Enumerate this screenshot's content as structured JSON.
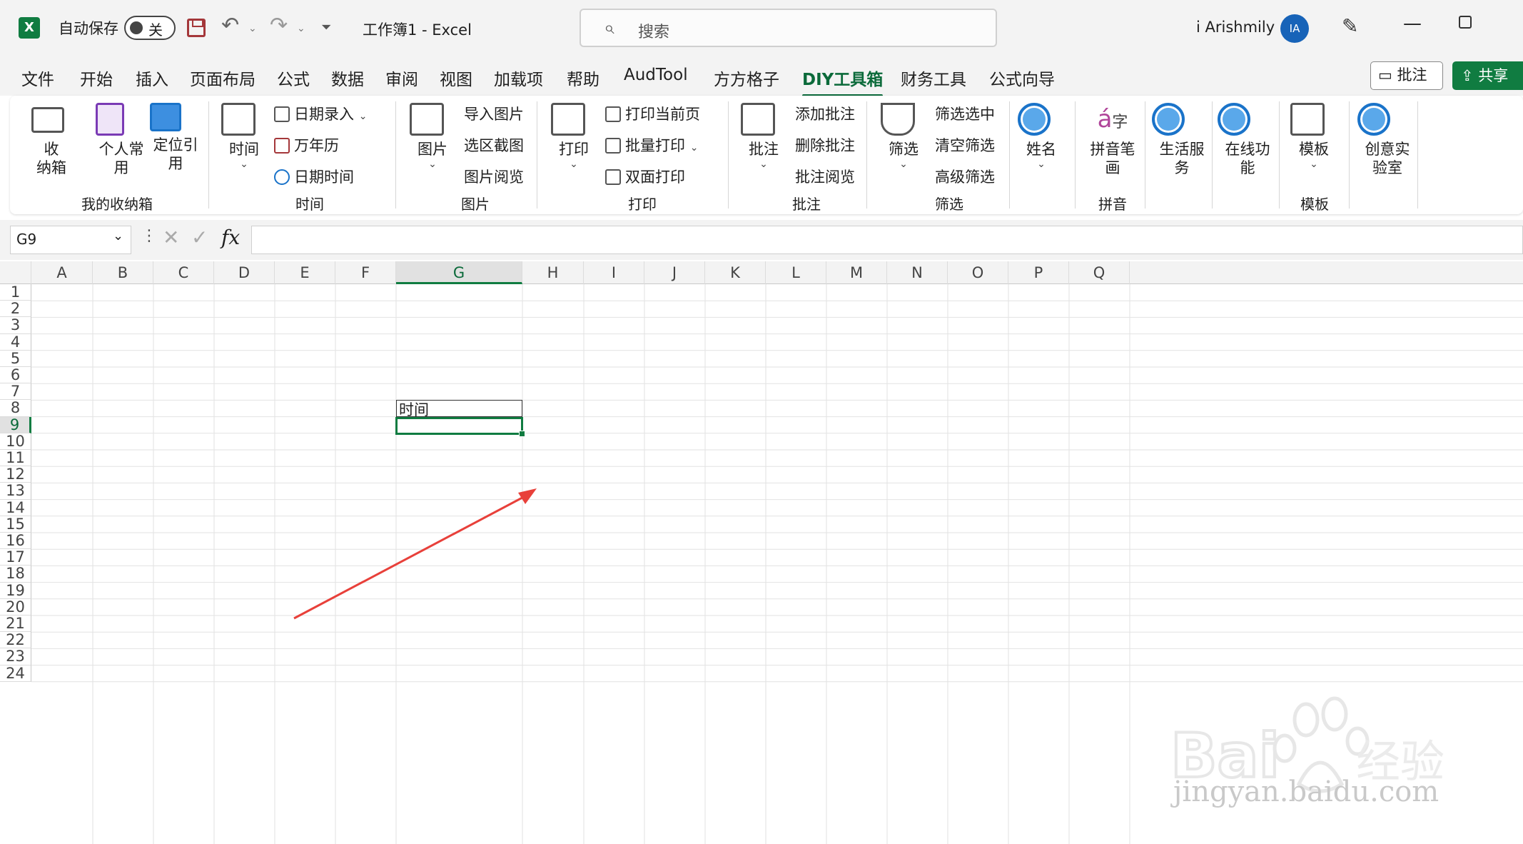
{
  "titlebar": {
    "autosave_label": "自动保存",
    "autosave_state": "关",
    "doc_title": "工作簿1  -  Excel",
    "search_placeholder": "搜索",
    "user_name": "i Arishmily",
    "avatar_initials": "IA",
    "app_logo": "X"
  },
  "tabs": [
    "文件",
    "开始",
    "插入",
    "页面布局",
    "公式",
    "数据",
    "审阅",
    "视图",
    "加载项",
    "帮助",
    "AudTool",
    "方方格子",
    "DIY工具箱",
    "财务工具",
    "公式向导"
  ],
  "active_tab": "DIY工具箱",
  "actions": {
    "comments_label": "批注",
    "share_label": "共享"
  },
  "ribbon": {
    "storage": {
      "btn1": "收\n纳箱",
      "btn2": "个人常\n用",
      "btn3": "定位引\n用",
      "group": "我的收纳箱"
    },
    "time": {
      "big": "时间",
      "s1": "日期录入",
      "s2": "万年历",
      "s3": "日期时间",
      "group": "时间"
    },
    "picture": {
      "big": "图片",
      "s1": "导入图片",
      "s2": "选区截图",
      "s3": "图片阅览",
      "group": "图片"
    },
    "print": {
      "big": "打印",
      "s1": "打印当前页",
      "s2": "批量打印",
      "s3": "双面打印",
      "group": "打印"
    },
    "comment": {
      "big": "批注",
      "s1": "添加批注",
      "s2": "删除批注",
      "s3": "批注阅览",
      "group": "批注"
    },
    "filter": {
      "big": "筛选",
      "s1": "筛选选中",
      "s2": "清空筛选",
      "s3": "高级筛选",
      "group": "筛选"
    },
    "name": {
      "big": "姓名"
    },
    "pinyin": {
      "big": "拼音笔\n画",
      "group": "拼音"
    },
    "life": {
      "big": "生活服\n务"
    },
    "online": {
      "big": "在线功\n能"
    },
    "template": {
      "big": "模板",
      "group": "模板"
    },
    "creative": {
      "big": "创意实\n验室"
    }
  },
  "formula_bar": {
    "name_box": "G9",
    "fx": "fx",
    "formula": ""
  },
  "sheet": {
    "columns": [
      "A",
      "B",
      "C",
      "D",
      "E",
      "F",
      "G",
      "H",
      "I",
      "J",
      "K",
      "L",
      "M",
      "N",
      "O",
      "P",
      "Q"
    ],
    "rows": [
      "1",
      "2",
      "3",
      "4",
      "5",
      "6",
      "7",
      "8",
      "9",
      "10",
      "11",
      "12",
      "13",
      "14",
      "15",
      "16",
      "17",
      "18",
      "19",
      "20",
      "21",
      "22",
      "23",
      "24"
    ],
    "selected_column": "G",
    "selected_row": "9",
    "cells": {
      "G8": "时间"
    }
  },
  "watermark": {
    "brand": "Bai du 经验",
    "url": "jingyan.baidu.com"
  },
  "colors": {
    "accent": "#107c41",
    "arrow": "#e8403a"
  }
}
